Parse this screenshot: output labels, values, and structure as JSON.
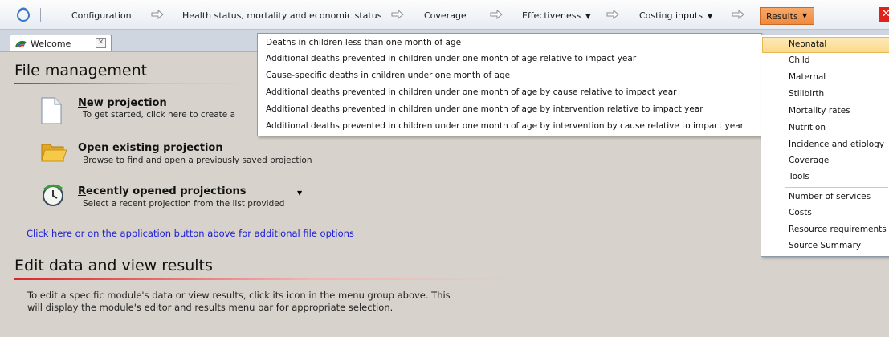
{
  "menubar": {
    "items": [
      {
        "label": "Configuration",
        "has_caret": false
      },
      {
        "label": "Health status, mortality and economic status",
        "has_caret": false
      },
      {
        "label": "Coverage",
        "has_caret": false
      },
      {
        "label": "Effectiveness",
        "has_caret": true
      },
      {
        "label": "Costing inputs",
        "has_caret": true
      }
    ],
    "results_label": "Results",
    "arrow_icon": "right-arrow-icon"
  },
  "tab": {
    "label": "Welcome",
    "close_glyph": "✕"
  },
  "file_management": {
    "heading": "File management",
    "new": {
      "title_u": "N",
      "title_rest": "ew projection",
      "desc": "To get started, click here to create a"
    },
    "open": {
      "title_u": "O",
      "title_rest": "pen existing projection",
      "desc": "Browse to find and open a previously saved projection"
    },
    "recent": {
      "title_u": "R",
      "title_rest": "ecently opened projections",
      "desc": "Select a recent projection from the list provided"
    },
    "link": "Click here or on the application button above for additional file options"
  },
  "edit_section": {
    "heading": "Edit data and view results",
    "text_line1": "To edit a specific module's data or view results, click its icon in the menu group above. This",
    "text_line2": "will display the module's editor and results menu bar for appropriate selection."
  },
  "results_menu": {
    "items": [
      "Neonatal",
      "Child",
      "Maternal",
      "Stillbirth",
      "Mortality rates",
      "Nutrition",
      "Incidence and etiology",
      "Coverage",
      "Tools",
      "Number of services",
      "Costs",
      "Resource requirements",
      "Source Summary"
    ],
    "highlighted": "Neonatal"
  },
  "neonatal_submenu": {
    "items": [
      "Deaths in children less than one month of age",
      "Additional deaths prevented in children under one month of age relative to impact year",
      "Cause-specific deaths in children under one month of age",
      "Additional deaths prevented in children under one month of age by cause relative to impact year",
      "Additional deaths prevented in children under one month of age by intervention relative to impact year",
      "Additional deaths prevented in children under one month of age by intervention by cause relative to impact year"
    ]
  },
  "colors": {
    "accent_orange": "#f08a3e",
    "link_blue": "#1a1ad6",
    "underline_red": "#d8262b",
    "highlight": "#fbd98a"
  }
}
